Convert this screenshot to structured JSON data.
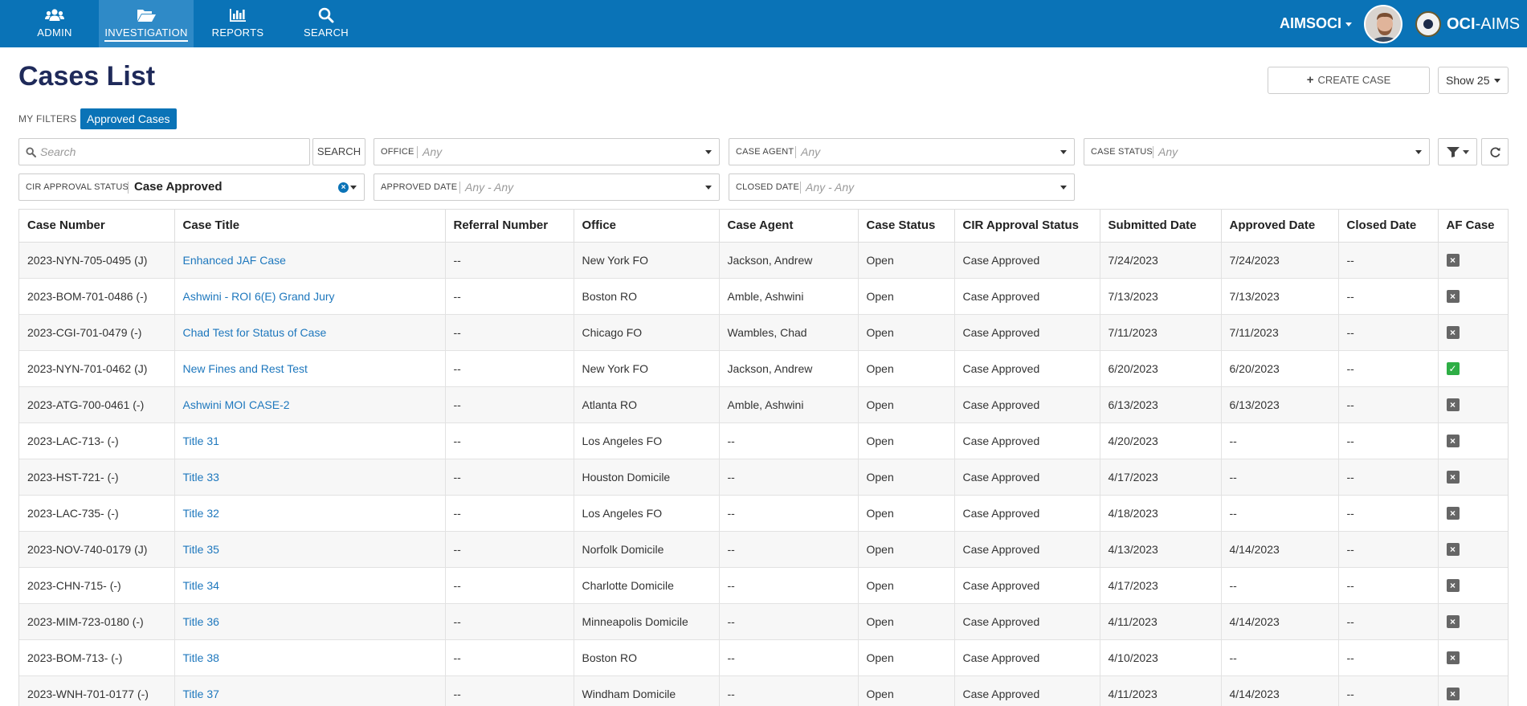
{
  "nav": {
    "items": [
      {
        "label": "ADMIN",
        "icon": "users-icon"
      },
      {
        "label": "INVESTIGATION",
        "icon": "folder-open-icon"
      },
      {
        "label": "REPORTS",
        "icon": "bar-chart-icon"
      },
      {
        "label": "SEARCH",
        "icon": "search-icon"
      }
    ],
    "active_item": "INVESTIGATION",
    "user": "AIMSOCI",
    "brand_bold": "OCI",
    "brand_rest": "-AIMS"
  },
  "header": {
    "title": "Cases List",
    "create_label": "CREATE CASE",
    "show_label": "Show 25"
  },
  "filters": {
    "my_filters_label": "MY FILTERS",
    "chip_label": "Approved Cases",
    "search_placeholder": "Search",
    "search_button": "SEARCH",
    "office": {
      "label": "OFFICE",
      "value": "Any"
    },
    "case_agent": {
      "label": "CASE AGENT",
      "value": "Any"
    },
    "case_status": {
      "label": "CASE STATUS",
      "value": "Any"
    },
    "cir_approval_status": {
      "label": "CIR APPROVAL STATUS",
      "value": "Case Approved"
    },
    "approved_date": {
      "label": "APPROVED DATE",
      "value": "Any - Any"
    },
    "closed_date": {
      "label": "CLOSED DATE",
      "value": "Any - Any"
    }
  },
  "colors": {
    "primary": "#0a73b7",
    "title": "#1f2a5a",
    "link": "#1d77bd",
    "check_yes": "#2eae45",
    "check_no": "#666666"
  },
  "table": {
    "columns": [
      "Case Number",
      "Case Title",
      "Referral Number",
      "Office",
      "Case Agent",
      "Case Status",
      "CIR Approval Status",
      "Submitted Date",
      "Approved Date",
      "Closed Date",
      "AF Case"
    ],
    "rows": [
      {
        "case_number": "2023-NYN-705-0495 (J)",
        "title": "Enhanced JAF Case",
        "referral": "--",
        "office": "New York FO",
        "agent": "Jackson, Andrew",
        "status": "Open",
        "cir": "Case Approved",
        "submitted": "7/24/2023",
        "approved": "7/24/2023",
        "closed": "--",
        "af_case": false
      },
      {
        "case_number": "2023-BOM-701-0486 (-)",
        "title": "Ashwini - ROI 6(E) Grand Jury",
        "referral": "--",
        "office": "Boston RO",
        "agent": "Amble, Ashwini",
        "status": "Open",
        "cir": "Case Approved",
        "submitted": "7/13/2023",
        "approved": "7/13/2023",
        "closed": "--",
        "af_case": false
      },
      {
        "case_number": "2023-CGI-701-0479 (-)",
        "title": "Chad Test for Status of Case",
        "referral": "--",
        "office": "Chicago FO",
        "agent": "Wambles, Chad",
        "status": "Open",
        "cir": "Case Approved",
        "submitted": "7/11/2023",
        "approved": "7/11/2023",
        "closed": "--",
        "af_case": false
      },
      {
        "case_number": "2023-NYN-701-0462 (J)",
        "title": "New Fines and Rest Test",
        "referral": "--",
        "office": "New York FO",
        "agent": "Jackson, Andrew",
        "status": "Open",
        "cir": "Case Approved",
        "submitted": "6/20/2023",
        "approved": "6/20/2023",
        "closed": "--",
        "af_case": true
      },
      {
        "case_number": "2023-ATG-700-0461 (-)",
        "title": "Ashwini MOI CASE-2",
        "referral": "--",
        "office": "Atlanta RO",
        "agent": "Amble, Ashwini",
        "status": "Open",
        "cir": "Case Approved",
        "submitted": "6/13/2023",
        "approved": "6/13/2023",
        "closed": "--",
        "af_case": false
      },
      {
        "case_number": "2023-LAC-713- (-)",
        "title": "Title 31",
        "referral": "--",
        "office": "Los Angeles FO",
        "agent": "--",
        "status": "Open",
        "cir": "Case Approved",
        "submitted": "4/20/2023",
        "approved": "--",
        "closed": "--",
        "af_case": false
      },
      {
        "case_number": "2023-HST-721- (-)",
        "title": "Title 33",
        "referral": "--",
        "office": "Houston Domicile",
        "agent": "--",
        "status": "Open",
        "cir": "Case Approved",
        "submitted": "4/17/2023",
        "approved": "--",
        "closed": "--",
        "af_case": false
      },
      {
        "case_number": "2023-LAC-735- (-)",
        "title": "Title 32",
        "referral": "--",
        "office": "Los Angeles FO",
        "agent": "--",
        "status": "Open",
        "cir": "Case Approved",
        "submitted": "4/18/2023",
        "approved": "--",
        "closed": "--",
        "af_case": false
      },
      {
        "case_number": "2023-NOV-740-0179 (J)",
        "title": "Title 35",
        "referral": "--",
        "office": "Norfolk Domicile",
        "agent": "--",
        "status": "Open",
        "cir": "Case Approved",
        "submitted": "4/13/2023",
        "approved": "4/14/2023",
        "closed": "--",
        "af_case": false
      },
      {
        "case_number": "2023-CHN-715- (-)",
        "title": "Title 34",
        "referral": "--",
        "office": "Charlotte Domicile",
        "agent": "--",
        "status": "Open",
        "cir": "Case Approved",
        "submitted": "4/17/2023",
        "approved": "--",
        "closed": "--",
        "af_case": false
      },
      {
        "case_number": "2023-MIM-723-0180 (-)",
        "title": "Title 36",
        "referral": "--",
        "office": "Minneapolis Domicile",
        "agent": "--",
        "status": "Open",
        "cir": "Case Approved",
        "submitted": "4/11/2023",
        "approved": "4/14/2023",
        "closed": "--",
        "af_case": false
      },
      {
        "case_number": "2023-BOM-713- (-)",
        "title": "Title 38",
        "referral": "--",
        "office": "Boston RO",
        "agent": "--",
        "status": "Open",
        "cir": "Case Approved",
        "submitted": "4/10/2023",
        "approved": "--",
        "closed": "--",
        "af_case": false
      },
      {
        "case_number": "2023-WNH-701-0177 (-)",
        "title": "Title 37",
        "referral": "--",
        "office": "Windham Domicile",
        "agent": "--",
        "status": "Open",
        "cir": "Case Approved",
        "submitted": "4/11/2023",
        "approved": "4/14/2023",
        "closed": "--",
        "af_case": false
      }
    ]
  }
}
